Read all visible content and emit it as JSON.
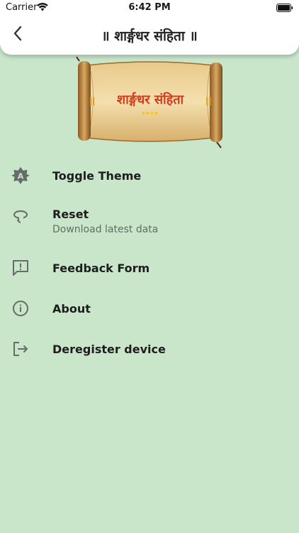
{
  "status_bar": {
    "carrier": "Carrier",
    "time": "6:42 PM"
  },
  "header": {
    "title": "॥ शार्ङ्गधर संहिता ॥",
    "back_icon": "chevron-left-icon"
  },
  "banner": {
    "text": "शार्ङ्गधर संहिता",
    "left_mark": "॥",
    "right_mark": "॥",
    "stars": "****"
  },
  "menu": {
    "items": [
      {
        "label": "Toggle Theme",
        "icon": "brightness-auto-icon"
      },
      {
        "label": "Reset",
        "subtitle": "Download latest data",
        "icon": "reset-icon"
      },
      {
        "label": "Feedback Form",
        "icon": "feedback-icon"
      },
      {
        "label": "About",
        "icon": "info-icon"
      },
      {
        "label": "Deregister device",
        "icon": "logout-icon"
      }
    ]
  },
  "colors": {
    "background": "#c9e6cb",
    "header": "#ffffff",
    "icon": "#666c67"
  }
}
